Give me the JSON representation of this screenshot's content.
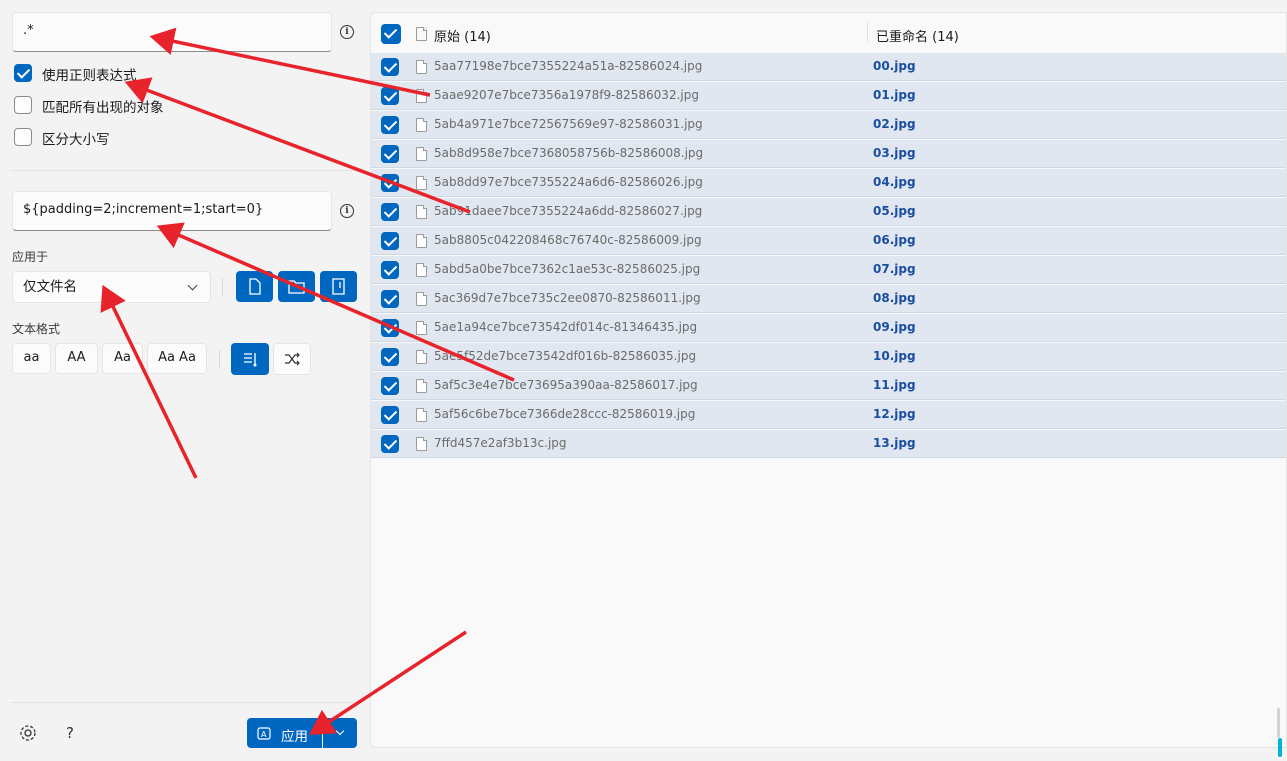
{
  "search": {
    "value": ".*"
  },
  "options": [
    {
      "label": "使用正则表达式",
      "checked": true
    },
    {
      "label": "匹配所有出现的对象",
      "checked": false
    },
    {
      "label": "区分大小写",
      "checked": false
    }
  ],
  "replace": {
    "value": "${padding=2;increment=1;start=0}"
  },
  "apply_to": {
    "label": "应用于",
    "selected": "仅文件名"
  },
  "text_format": {
    "label": "文本格式",
    "buttons": [
      "aa",
      "AA",
      "Aa",
      "Aa Aa"
    ]
  },
  "footer": {
    "apply_label": "应用"
  },
  "list": {
    "header_original": "原始 (14)",
    "header_renamed": "已重命名 (14)",
    "rows": [
      {
        "original": "5aa77198e7bce7355224a51a-82586024.jpg",
        "renamed": "00.jpg"
      },
      {
        "original": "5aae9207e7bce7356a1978f9-82586032.jpg",
        "renamed": "01.jpg"
      },
      {
        "original": "5ab4a971e7bce72567569e97-82586031.jpg",
        "renamed": "02.jpg"
      },
      {
        "original": "5ab8d958e7bce7368058756b-82586008.jpg",
        "renamed": "03.jpg"
      },
      {
        "original": "5ab8dd97e7bce7355224a6d6-82586026.jpg",
        "renamed": "04.jpg"
      },
      {
        "original": "5ab91daee7bce7355224a6dd-82586027.jpg",
        "renamed": "05.jpg"
      },
      {
        "original": "5ab8805c042208468c76740c-82586009.jpg",
        "renamed": "06.jpg"
      },
      {
        "original": "5abd5a0be7bce7362c1ae53c-82586025.jpg",
        "renamed": "07.jpg"
      },
      {
        "original": "5ac369d7e7bce735c2ee0870-82586011.jpg",
        "renamed": "08.jpg"
      },
      {
        "original": "5ae1a94ce7bce73542df014c-81346435.jpg",
        "renamed": "09.jpg"
      },
      {
        "original": "5ae5f52de7bce73542df016b-82586035.jpg",
        "renamed": "10.jpg"
      },
      {
        "original": "5af5c3e4e7bce73695a390aa-82586017.jpg",
        "renamed": "11.jpg"
      },
      {
        "original": "5af56c6be7bce7366de28ccc-82586019.jpg",
        "renamed": "12.jpg"
      },
      {
        "original": "7ffd457e2af3b13c.jpg",
        "renamed": "13.jpg"
      }
    ]
  },
  "colors": {
    "accent": "#0067c0",
    "annotation": "#e8232b",
    "row_bg": "#e1e7f0"
  }
}
